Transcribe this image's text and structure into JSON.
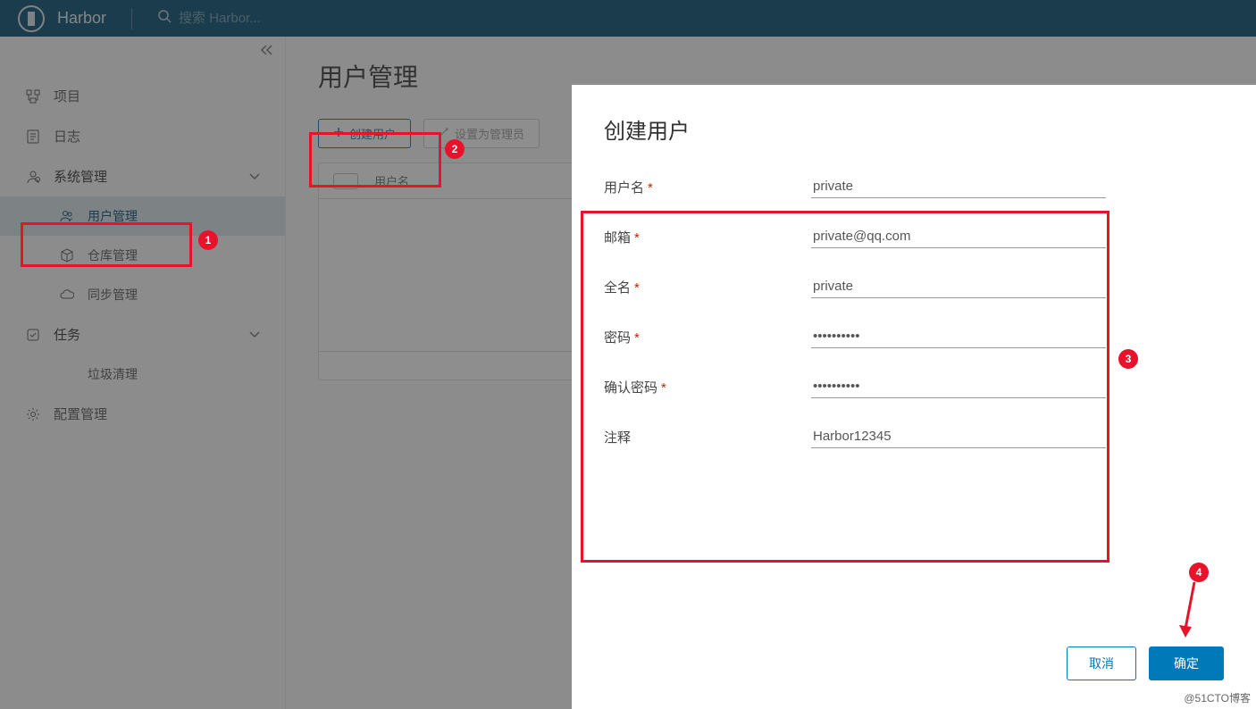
{
  "header": {
    "brand": "Harbor",
    "search_placeholder": "搜索 Harbor..."
  },
  "sidebar": {
    "items": {
      "projects": "项目",
      "logs": "日志",
      "system_mgmt": "系统管理",
      "user_mgmt": "用户管理",
      "repo_mgmt": "仓库管理",
      "replication_mgmt": "同步管理",
      "tasks": "任务",
      "garbage": "垃圾清理",
      "config": "配置管理"
    }
  },
  "main": {
    "title": "用户管理",
    "create_btn": "创建用户",
    "set_admin_btn": "设置为管理员",
    "table_header_username": "用户名"
  },
  "modal": {
    "title": "创建用户",
    "labels": {
      "username": "用户名",
      "email": "邮箱",
      "fullname": "全名",
      "password": "密码",
      "confirm_password": "确认密码",
      "comment": "注释"
    },
    "values": {
      "username": "private",
      "email": "private@qq.com",
      "fullname": "private",
      "password": "••••••••••",
      "confirm_password": "••••••••••",
      "comment": "Harbor12345"
    },
    "cancel": "取消",
    "confirm": "确定"
  },
  "annotations": {
    "b1": "1",
    "b2": "2",
    "b3": "3",
    "b4": "4"
  },
  "watermark": "@51CTO博客"
}
